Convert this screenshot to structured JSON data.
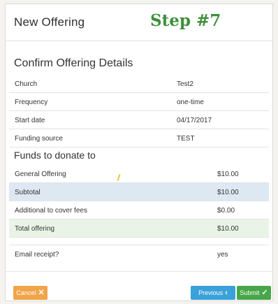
{
  "header": {
    "title": "New Offering",
    "step_label": "Step #7"
  },
  "confirm": {
    "title": "Confirm Offering Details",
    "rows": [
      {
        "label": "Church",
        "value": "Test2"
      },
      {
        "label": "Frequency",
        "value": "one-time"
      },
      {
        "label": "Start date",
        "value": "04/17/2017"
      },
      {
        "label": "Funding source",
        "value": "TEST"
      }
    ]
  },
  "funds": {
    "title": "Funds to donate to",
    "general": {
      "label": "General Offering",
      "value": "$10.00"
    },
    "subtotal": {
      "label": "Subtotal",
      "value": "$10.00"
    },
    "fees": {
      "label": "Additional to cover fees",
      "value": "$0.00"
    },
    "total": {
      "label": "Total offering",
      "value": "$10.00"
    }
  },
  "email": {
    "label": "Email receipt?",
    "value": "yes"
  },
  "buttons": {
    "cancel": {
      "label": "Cancel",
      "icon": "x-icon"
    },
    "previous": {
      "label": "Previous",
      "icon": "chevron-left-icon"
    },
    "submit": {
      "label": "Submit",
      "icon": "check-icon"
    }
  },
  "colors": {
    "step_green": "#3f8f3c",
    "cancel_orange": "#f2a44a",
    "previous_blue": "#3aa1da",
    "submit_green": "#47a64a",
    "subtotal_bg": "#dde8f3",
    "total_bg": "#e9f4e6"
  }
}
